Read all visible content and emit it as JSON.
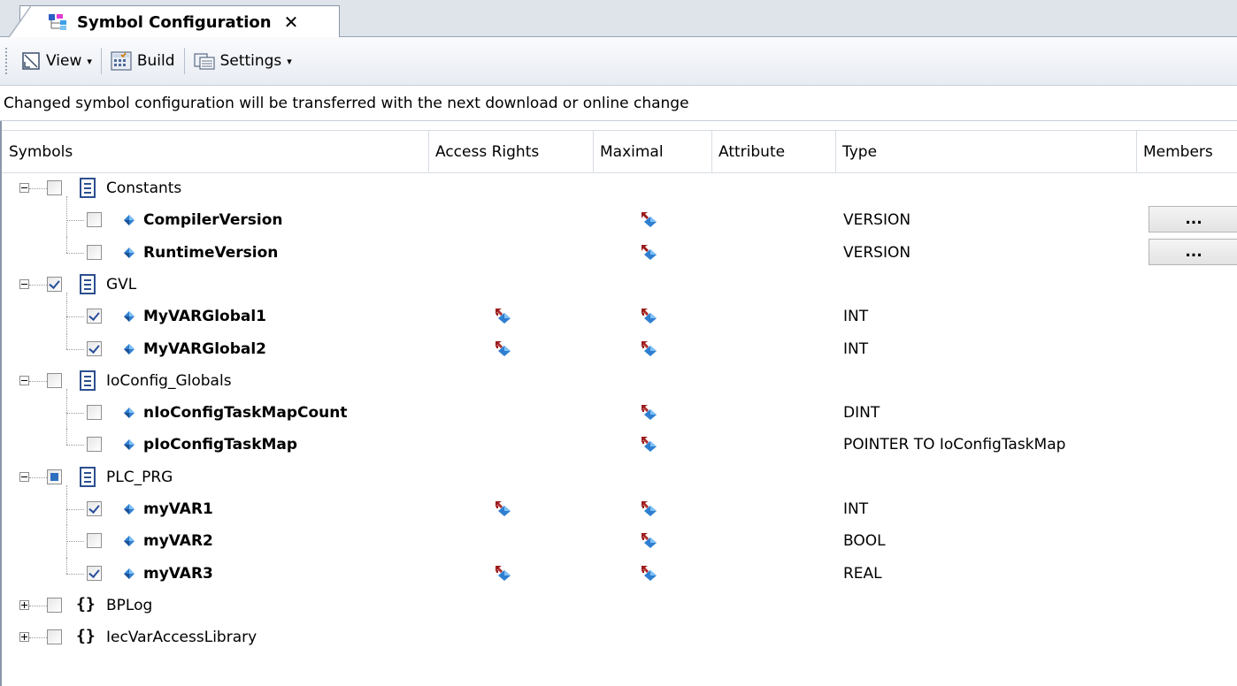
{
  "tab": {
    "title": "Symbol Configuration",
    "close_glyph": "✕"
  },
  "toolbar": {
    "view_label": "View",
    "build_label": "Build",
    "settings_label": "Settings",
    "dropdown_glyph": "▾"
  },
  "info_message": "Changed symbol configuration will be transferred with the next download or online change",
  "columns": {
    "symbols": "Symbols",
    "access_rights": "Access Rights",
    "maximal": "Maximal",
    "attribute": "Attribute",
    "type": "Type",
    "members": "Members"
  },
  "rows": [
    {
      "kind": "group",
      "name": "Constants",
      "icon": "document-icon",
      "expanded": true,
      "check": "unchecked"
    },
    {
      "kind": "var",
      "name": "CompilerVersion",
      "check": "unchecked",
      "access": "",
      "maximal": "read-icon",
      "type": "VERSION",
      "members": "..."
    },
    {
      "kind": "var",
      "name": "RuntimeVersion",
      "check": "unchecked",
      "access": "",
      "maximal": "read-icon",
      "type": "VERSION",
      "members": "..."
    },
    {
      "kind": "group",
      "name": "GVL",
      "icon": "document-icon",
      "expanded": true,
      "check": "checked"
    },
    {
      "kind": "var",
      "name": "MyVARGlobal1",
      "check": "checked",
      "access": "read-write-icon",
      "maximal": "read-write-icon",
      "type": "INT"
    },
    {
      "kind": "var",
      "name": "MyVARGlobal2",
      "check": "checked",
      "access": "read-write-icon",
      "maximal": "read-write-icon",
      "type": "INT"
    },
    {
      "kind": "group",
      "name": "IoConfig_Globals",
      "icon": "document-icon",
      "expanded": true,
      "check": "unchecked"
    },
    {
      "kind": "var",
      "name": "nIoConfigTaskMapCount",
      "check": "unchecked",
      "access": "",
      "maximal": "read-write-icon",
      "type": "DINT"
    },
    {
      "kind": "var",
      "name": "pIoConfigTaskMap",
      "check": "unchecked",
      "access": "",
      "maximal": "read-write-icon",
      "type": "POINTER TO IoConfigTaskMap"
    },
    {
      "kind": "group",
      "name": "PLC_PRG",
      "icon": "document-icon",
      "expanded": true,
      "check": "partial"
    },
    {
      "kind": "var",
      "name": "myVAR1",
      "check": "checked",
      "access": "read-write-icon",
      "maximal": "read-write-icon",
      "type": "INT"
    },
    {
      "kind": "var",
      "name": "myVAR2",
      "check": "unchecked",
      "access": "",
      "maximal": "read-write-icon",
      "type": "BOOL"
    },
    {
      "kind": "var",
      "name": "myVAR3",
      "check": "checked",
      "access": "read-write-icon",
      "maximal": "read-write-icon",
      "type": "REAL"
    },
    {
      "kind": "library",
      "name": "BPLog",
      "icon": "braces-icon",
      "expanded": false,
      "check": "unchecked"
    },
    {
      "kind": "library",
      "name": "IecVarAccessLibrary",
      "icon": "braces-icon",
      "expanded": false,
      "check": "unchecked"
    }
  ],
  "colors": {
    "tab_bg": "#dfe3ea",
    "border": "#8a96a8",
    "checkbox_mark": "#2a4f9a",
    "var_icon_blue": "#2f7fd1",
    "access_arrow_red": "#9b1b1b"
  }
}
